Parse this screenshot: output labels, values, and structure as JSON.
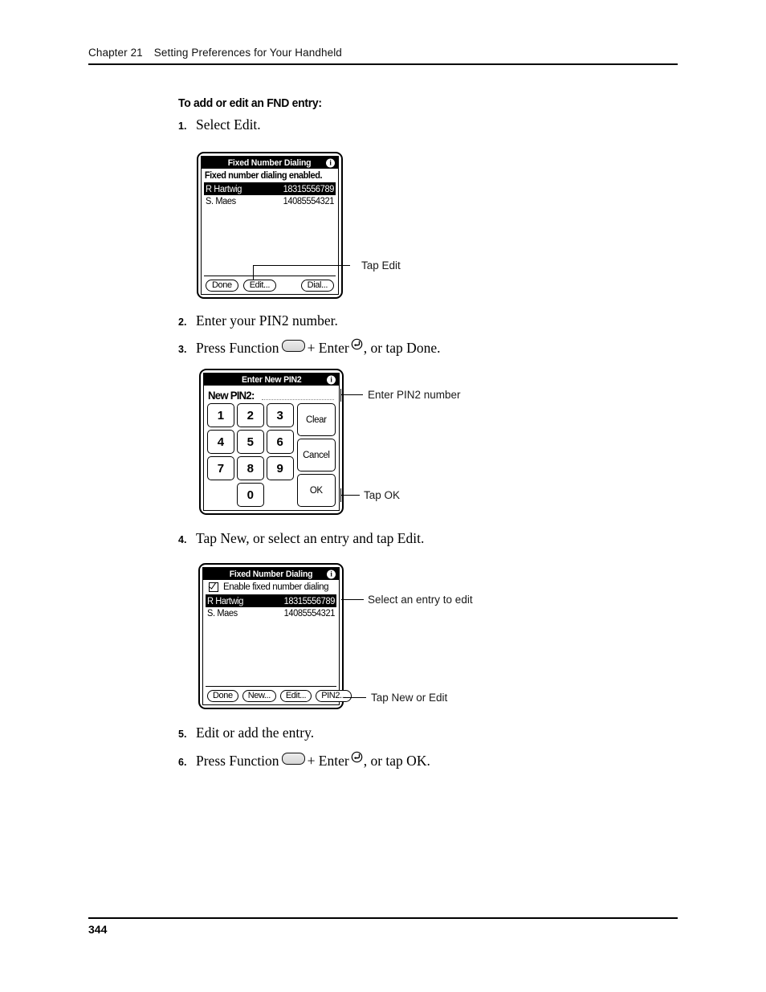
{
  "header": {
    "chapter": "Chapter 21",
    "title": "Setting Preferences for Your Handheld"
  },
  "section": {
    "heading": "To add or edit an FND entry:"
  },
  "steps": [
    {
      "num": "1.",
      "text": "Select Edit."
    },
    {
      "num": "2.",
      "text": "Enter your PIN2 number."
    },
    {
      "num": "3.",
      "pre": "Press Function",
      "mid": "+ Enter",
      "post": ", or tap Done."
    },
    {
      "num": "4.",
      "text": "Tap New, or select an entry and tap Edit."
    },
    {
      "num": "5.",
      "text": "Edit or add the entry."
    },
    {
      "num": "6.",
      "pre": "Press Function",
      "mid": "+ Enter",
      "post": ", or tap OK."
    }
  ],
  "callouts": {
    "tap_edit": "Tap Edit",
    "enter_pin2_number": "Enter PIN2 number",
    "tap_ok": "Tap OK",
    "select_entry_to_edit": "Select an entry to edit",
    "tap_new_or_edit": "Tap New or Edit"
  },
  "screen1": {
    "title": "Fixed Number Dialing",
    "info_icon": "i",
    "banner": "Fixed number dialing enabled.",
    "entries": [
      {
        "name": "R Hartwig",
        "number": "18315556789",
        "selected": true
      },
      {
        "name": "S. Maes",
        "number": "14085554321",
        "selected": false
      }
    ],
    "buttons": [
      {
        "label": "Done"
      },
      {
        "label": "Edit..."
      },
      {
        "label": "Dial..."
      }
    ]
  },
  "screen2": {
    "title": "Enter New PIN2",
    "info_icon": "i",
    "field_label": "New PIN2:",
    "field_value": "",
    "digits": [
      "1",
      "2",
      "3",
      "4",
      "5",
      "6",
      "7",
      "8",
      "9",
      "0"
    ],
    "actions": [
      "Clear",
      "Cancel",
      "OK"
    ]
  },
  "screen3": {
    "title": "Fixed Number Dialing",
    "info_icon": "i",
    "checkbox_label": "Enable fixed number dialing",
    "checkbox_checked": true,
    "entries": [
      {
        "name": "R Hartwig",
        "number": "18315556789",
        "selected": true
      },
      {
        "name": "S. Maes",
        "number": "14085554321",
        "selected": false
      }
    ],
    "buttons": [
      {
        "label": "Done"
      },
      {
        "label": "New..."
      },
      {
        "label": "Edit..."
      },
      {
        "label": "PIN2..."
      }
    ]
  },
  "footer": {
    "page_number": "344"
  }
}
